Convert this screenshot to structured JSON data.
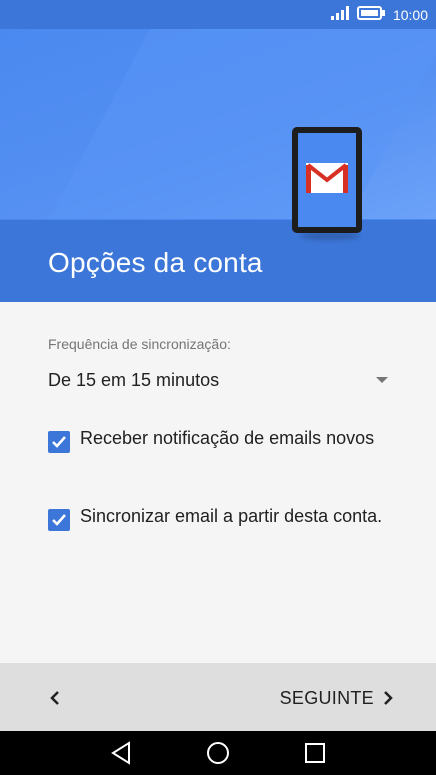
{
  "status_bar": {
    "time": "10:00"
  },
  "header": {
    "title": "Opções da conta"
  },
  "sync": {
    "label": "Frequência de sincronização:",
    "selected": "De 15 em 15 minutos"
  },
  "options": [
    {
      "label": "Receber notificação de emails novos",
      "checked": true
    },
    {
      "label": "Sincronizar email a partir desta conta.",
      "checked": true
    }
  ],
  "footer": {
    "next_label": "SEGUINTE"
  },
  "colors": {
    "accent": "#3c76d8",
    "header": "#4a89f0",
    "gmail_red": "#d93025"
  },
  "icons": {
    "signal": "signal-icon",
    "battery": "battery-icon",
    "mail": "gmail-icon",
    "back": "chevron-left-icon",
    "next": "chevron-right-icon",
    "nav_back": "triangle-back-icon",
    "nav_home": "circle-home-icon",
    "nav_recent": "square-recents-icon"
  }
}
